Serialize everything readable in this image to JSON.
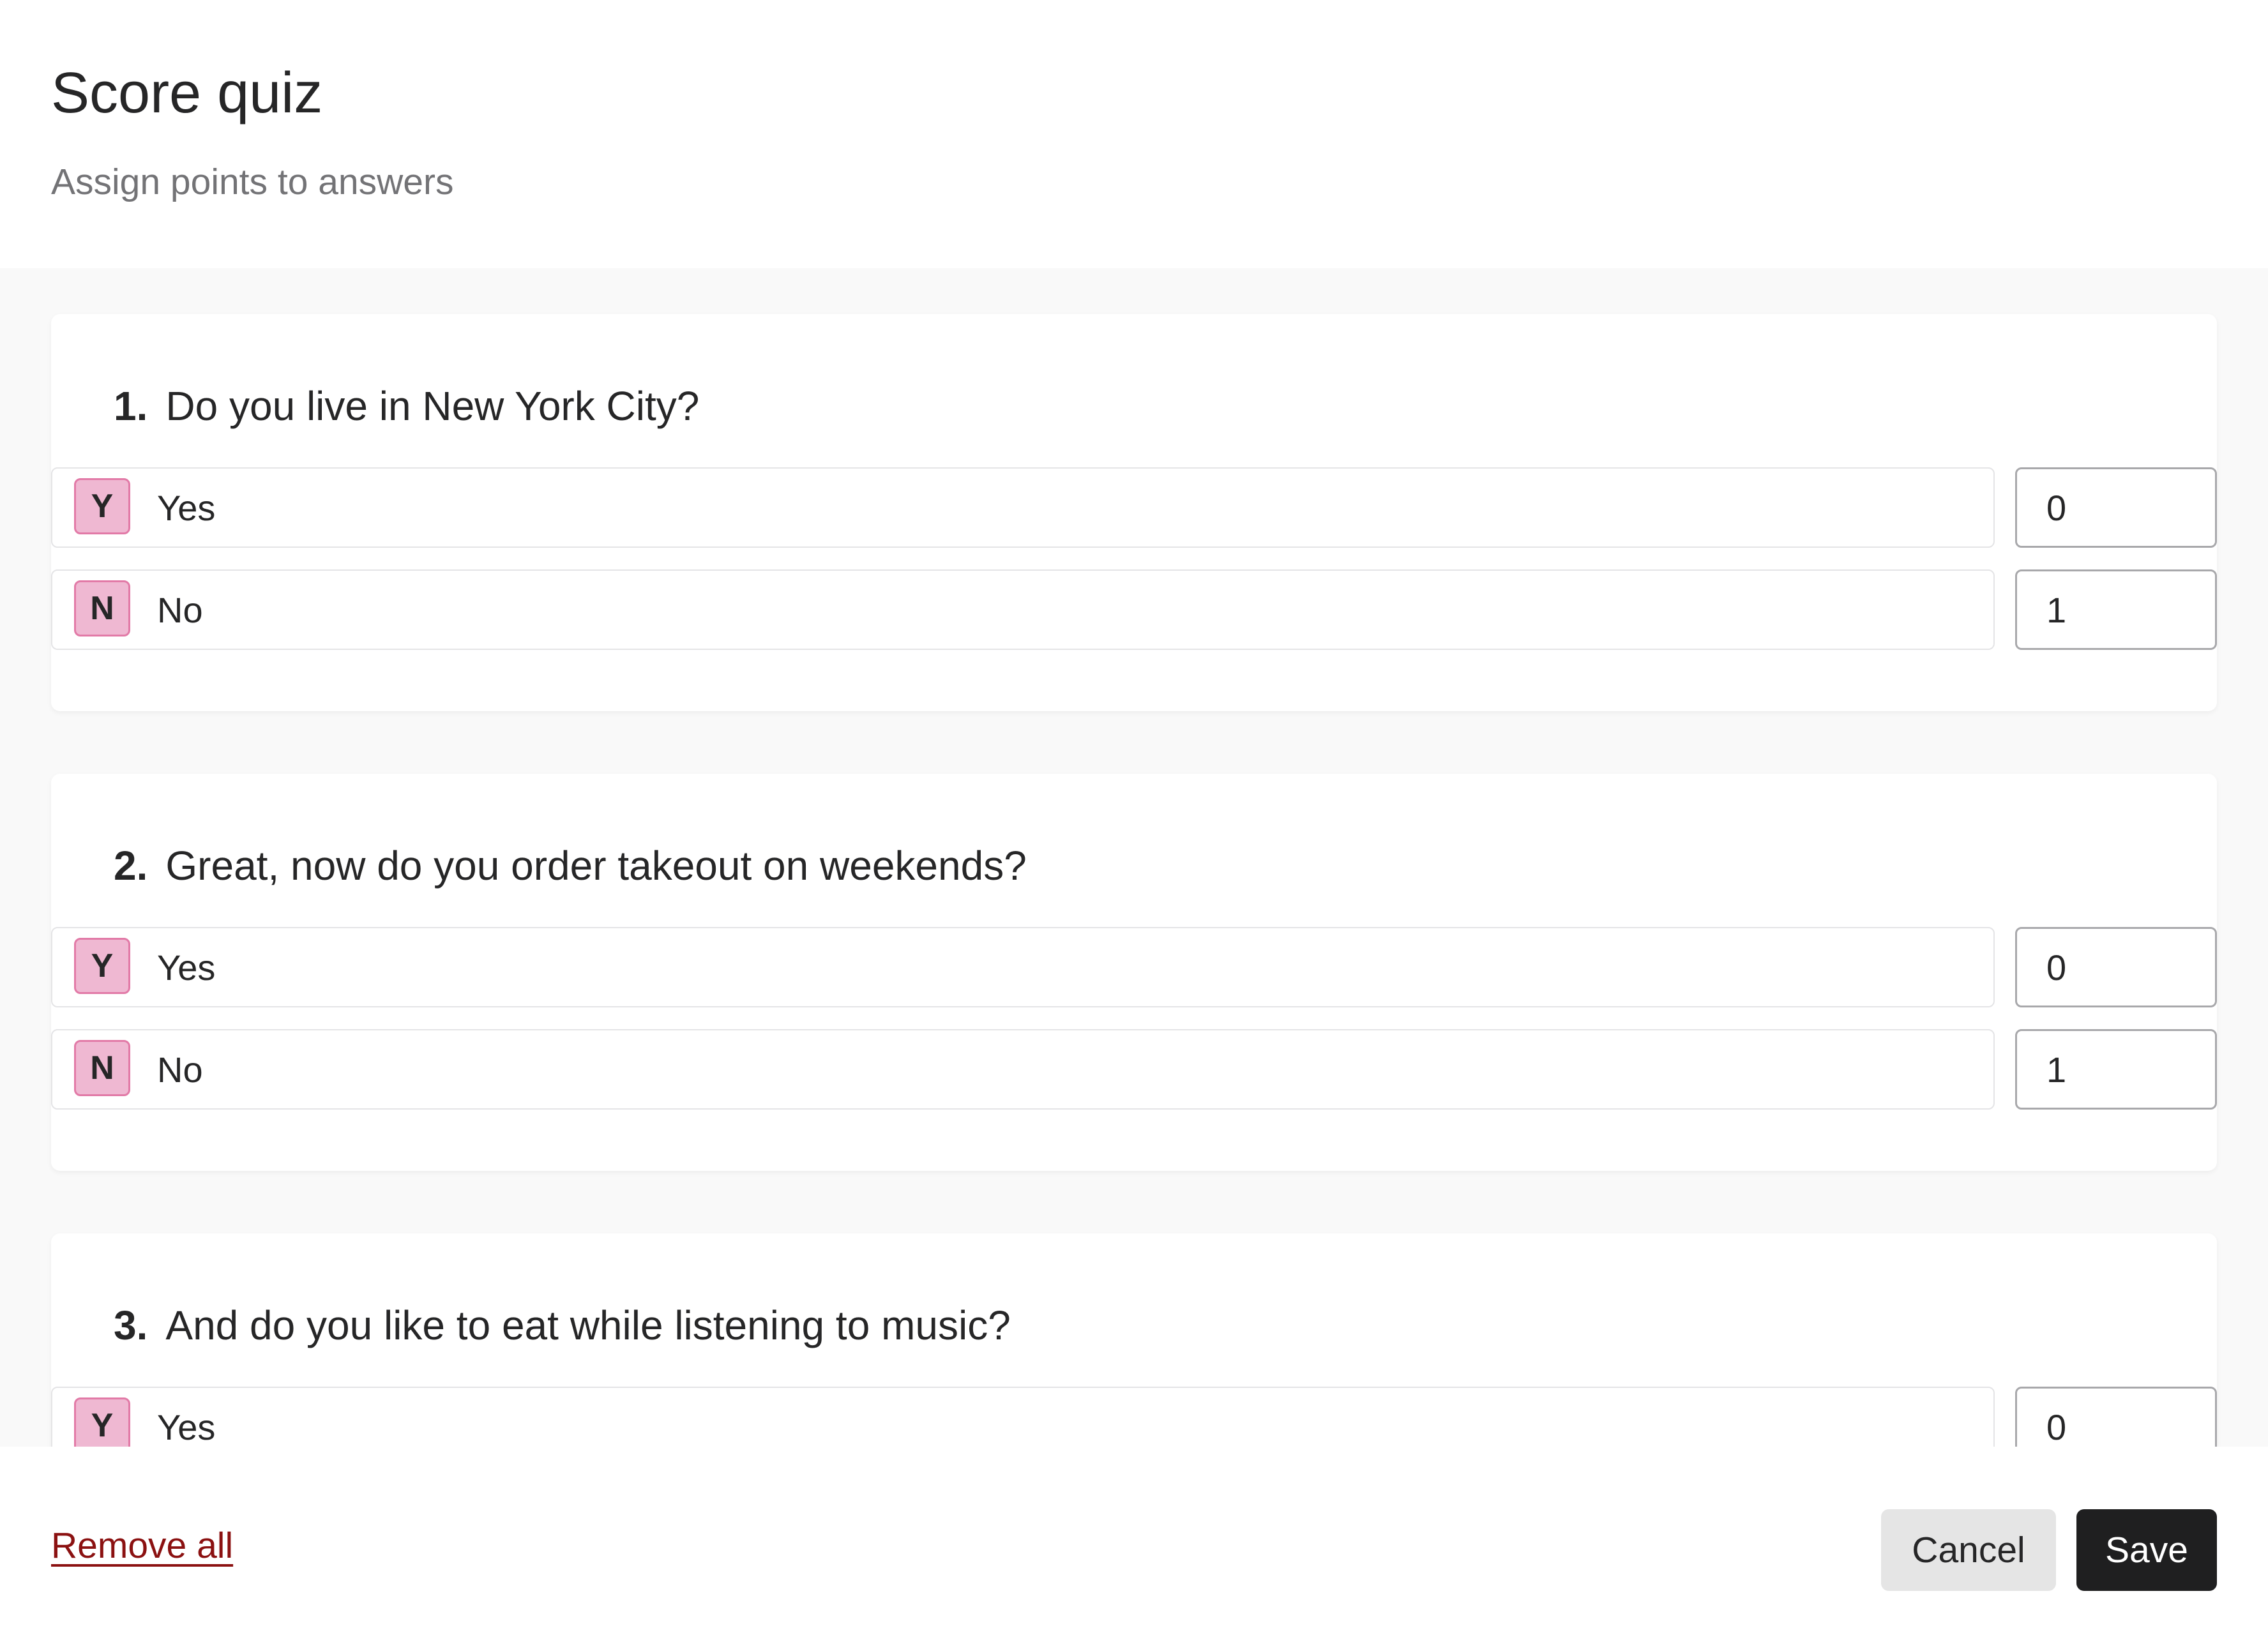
{
  "header": {
    "title": "Score quiz",
    "subtitle": "Assign points to answers"
  },
  "questions": [
    {
      "number": "1.",
      "text": "Do you live in New York City?",
      "answers": [
        {
          "key": "Y",
          "label": "Yes",
          "score": "0"
        },
        {
          "key": "N",
          "label": "No",
          "score": "1"
        }
      ]
    },
    {
      "number": "2.",
      "text": "Great, now do you order takeout on weekends?",
      "answers": [
        {
          "key": "Y",
          "label": "Yes",
          "score": "0"
        },
        {
          "key": "N",
          "label": "No",
          "score": "1"
        }
      ]
    },
    {
      "number": "3.",
      "text": "And do you like to eat while listening to music?",
      "answers": [
        {
          "key": "Y",
          "label": "Yes",
          "score": "0"
        }
      ]
    }
  ],
  "footer": {
    "remove_all_label": "Remove all",
    "cancel_label": "Cancel",
    "save_label": "Save"
  },
  "colors": {
    "key_badge_fill": "#efb8d2",
    "key_badge_border": "#e27aa7",
    "danger_link": "#8b1111",
    "primary_button": "#1f1f20",
    "secondary_button": "#e5e5e5",
    "body_background": "#f9f9f9"
  }
}
